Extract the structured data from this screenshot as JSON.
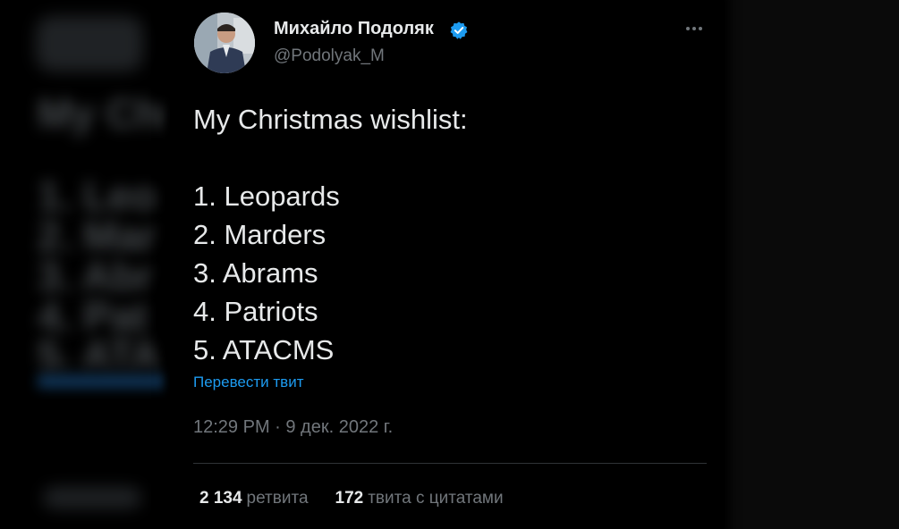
{
  "tweet": {
    "author": {
      "display_name": "Михайло Подоляк",
      "handle": "@Podolyak_M",
      "verified": true,
      "avatar_icon": "profile-photo"
    },
    "body_lines": [
      "My Christmas wishlist:",
      "",
      "1. Leopards",
      "2. Marders",
      "3. Abrams",
      "4. Patriots",
      "5. ATACMS"
    ],
    "translate_label": "Перевести твит",
    "timestamp": "12:29 PM · 9 дек. 2022 г.",
    "stats": {
      "retweets_count": "2 134",
      "retweets_label": "ретвита",
      "quotes_count": "172",
      "quotes_label": "твита с цитатами"
    },
    "more_icon": "more-options-icon"
  },
  "colors": {
    "background": "#000000",
    "primary_text": "#e7e9ea",
    "secondary_text": "#71767b",
    "link": "#1d9bf0",
    "verified_badge": "#1d9bf0",
    "divider": "#2f3336"
  }
}
